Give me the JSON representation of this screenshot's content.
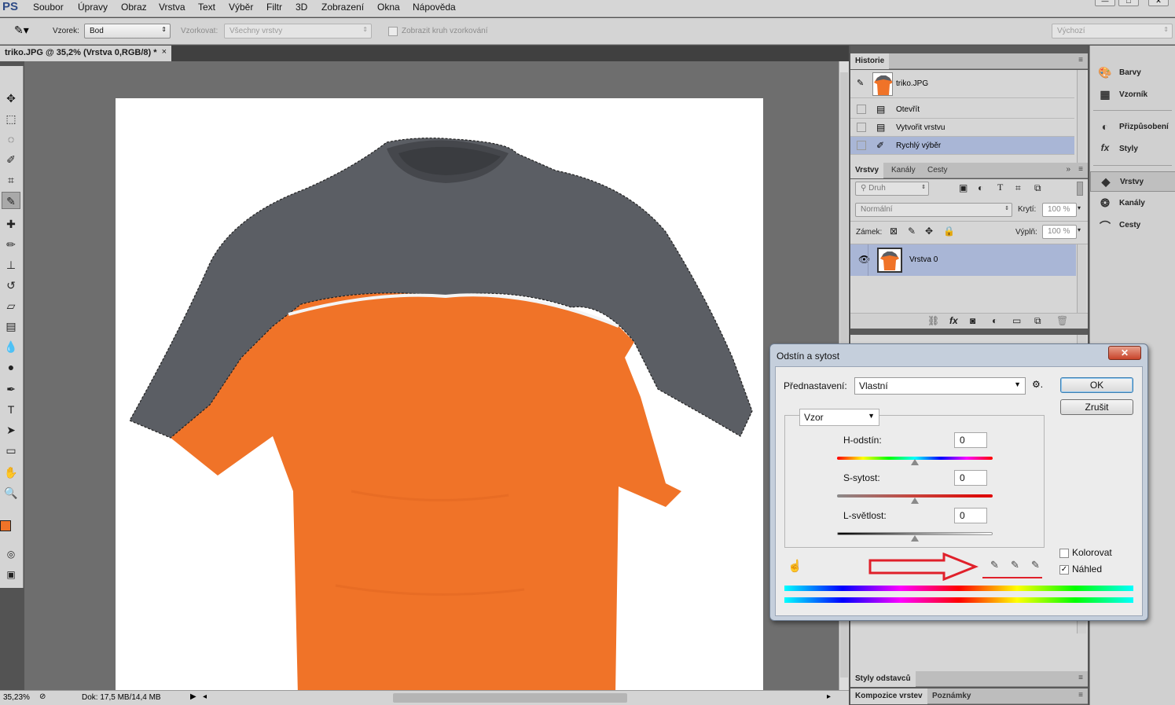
{
  "menubar": {
    "logo": "PS",
    "items": [
      "Soubor",
      "Úpravy",
      "Obraz",
      "Vrstva",
      "Text",
      "Výběr",
      "Filtr",
      "3D",
      "Zobrazení",
      "Okna",
      "Nápověda"
    ]
  },
  "options": {
    "sample_label": "Vzorek:",
    "sample_value": "Bod",
    "sampling_label": "Vzorkovat:",
    "sampling_value": "Všechny vrstvy",
    "show_ring_label": "Zobrazit kruh vzorkování",
    "workspace_value": "Výchozí"
  },
  "document": {
    "tab_title": "triko.JPG @ 35,2% (Vrstva 0,RGB/8) *",
    "close_glyph": "×"
  },
  "statusbar": {
    "zoom": "35,23%",
    "doc_info": "Dok: 17,5 MB/14,4 MB"
  },
  "history": {
    "title": "Historie",
    "snapshot": "triko.JPG",
    "items": [
      "Otevřít",
      "Vytvořit vrstvu",
      "Rychlý výběr"
    ],
    "selected_index": 2
  },
  "layers_panel": {
    "tabs": [
      "Vrstvy",
      "Kanály",
      "Cesty"
    ],
    "filter_value": "Druh",
    "blend_mode": "Normální",
    "opacity_label": "Krytí:",
    "opacity_value": "100 %",
    "lock_label": "Zámek:",
    "fill_label": "Výplň:",
    "fill_value": "100 %",
    "layer_name": "Vrstva 0"
  },
  "bottom_panels": {
    "styles_title": "Styly odstavců",
    "comp_tab": "Kompozice vrstev",
    "notes_tab": "Poznámky"
  },
  "dock": {
    "items": [
      "Barvy",
      "Vzorník",
      "Přizpůsobení",
      "Styly",
      "Vrstvy",
      "Kanály",
      "Cesty"
    ],
    "active": "Vrstvy"
  },
  "dialog": {
    "title": "Odstín a sytost",
    "close_glyph": "✕",
    "preset_label": "Přednastavení:",
    "preset_value": "Vlastní",
    "ok_label": "OK",
    "cancel_label": "Zrušit",
    "channel_value": "Vzor",
    "hue_label": "H-odstín:",
    "hue_value": "0",
    "saturation_label": "S-sytost:",
    "saturation_value": "0",
    "lightness_label": "L-světlost:",
    "lightness_value": "0",
    "colorize_label": "Kolorovat",
    "colorize_checked": false,
    "preview_label": "Náhled",
    "preview_checked": true
  },
  "colors": {
    "foreground": "#f07328",
    "background": "#2f63b6",
    "shirt_orange": "#f07328",
    "shirt_gray": "#5b5e64",
    "selection_blue": "#a9b6d6",
    "annotation_red": "#e0202a"
  }
}
